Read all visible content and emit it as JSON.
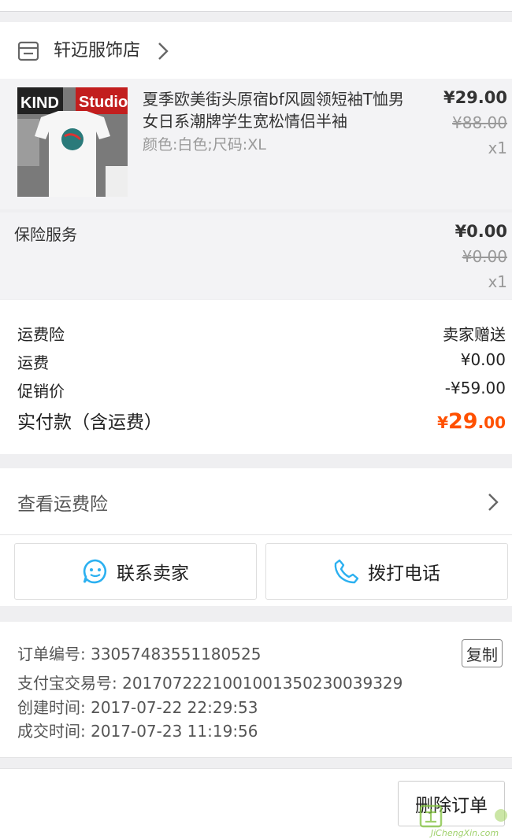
{
  "shop": {
    "name": "轩迈服饰店"
  },
  "item": {
    "title": "夏季欧美街头原宿bf风圆领短袖T恤男女日系潮牌学生宽松情侣半袖",
    "spec": "颜色:白色;尺码:XL",
    "price": "¥29.00",
    "original_price": "¥88.00",
    "qty": "x1",
    "thumb_text_1": "KIND",
    "thumb_text_2": "Studio"
  },
  "insurance": {
    "label": "保险服务",
    "price": "¥0.00",
    "original_price": "¥0.00",
    "qty": "x1"
  },
  "summary": {
    "freight_insurance_label": "运费险",
    "freight_insurance_value": "卖家赠送",
    "shipping_label": "运费",
    "shipping_value": "¥0.00",
    "promo_label": "促销价",
    "promo_value": "-¥59.00",
    "paid_label": "实付款（含运费）",
    "paid_currency": "¥",
    "paid_int": "29",
    "paid_dec": ".00"
  },
  "freight_link": {
    "label": "查看运费险"
  },
  "actions": {
    "contact_seller": "联系卖家",
    "call_phone": "拨打电话"
  },
  "order_info": {
    "order_no": "订单编号: 33057483551180525",
    "alipay_no": "支付宝交易号: 2017072221001001350230039329",
    "created": "创建时间: 2017-07-22 22:29:53",
    "closed": "成交时间: 2017-07-23 11:19:56",
    "copy_label": "复制"
  },
  "bottom": {
    "delete_label": "删除订单"
  },
  "watermark": {
    "text": "JiChengXin.com"
  },
  "colors": {
    "accent": "#ff5000",
    "icon_blue": "#2bb0f0"
  }
}
